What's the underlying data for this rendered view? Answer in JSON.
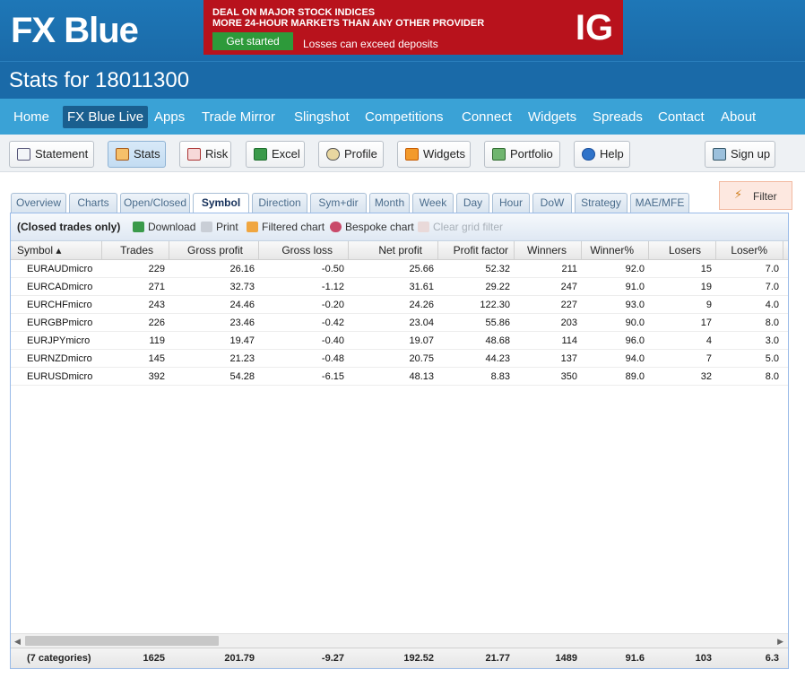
{
  "brand": {
    "logo_text": "FX Blue"
  },
  "ad": {
    "line1": "DEAL ON MAJOR STOCK INDICES",
    "line2": "MORE 24-HOUR MARKETS THAN ANY OTHER PROVIDER",
    "cta": "Get started",
    "note": "Losses can exceed deposits",
    "logo": "IG"
  },
  "page_title": "Stats for 18011300",
  "main_nav": [
    {
      "label": "Home"
    },
    {
      "label": "FX Blue Live",
      "active": true
    },
    {
      "label": "Apps"
    },
    {
      "label": "Trade Mirror"
    },
    {
      "label": "Slingshot"
    },
    {
      "label": "Competitions"
    },
    {
      "label": "Connect"
    },
    {
      "label": "Widgets"
    },
    {
      "label": "Spreads"
    },
    {
      "label": "Contact"
    },
    {
      "label": "About"
    }
  ],
  "toolbar": {
    "statement": "Statement",
    "stats": "Stats",
    "risk": "Risk",
    "excel": "Excel",
    "profile": "Profile",
    "widgets": "Widgets",
    "portfolio": "Portfolio",
    "help": "Help",
    "signup": "Sign up"
  },
  "filter_label": "Filter",
  "tabs": [
    {
      "label": "Overview"
    },
    {
      "label": "Charts"
    },
    {
      "label": "Open/Closed"
    },
    {
      "label": "Symbol",
      "active": true
    },
    {
      "label": "Direction"
    },
    {
      "label": "Sym+dir"
    },
    {
      "label": "Month"
    },
    {
      "label": "Week"
    },
    {
      "label": "Day"
    },
    {
      "label": "Hour"
    },
    {
      "label": "DoW"
    },
    {
      "label": "Strategy"
    },
    {
      "label": "MAE/MFE"
    }
  ],
  "grid_toolbar": {
    "title": "(Closed trades only)",
    "download": "Download",
    "print": "Print",
    "filtered_chart": "Filtered chart",
    "bespoke_chart": "Bespoke chart",
    "clear_filter": "Clear grid filter"
  },
  "grid": {
    "columns": [
      "Symbol ▴",
      "Trades",
      "Gross profit",
      "Gross loss",
      "Net profit",
      "Profit factor",
      "Winners",
      "Winner%",
      "Losers",
      "Loser%"
    ],
    "rows": [
      [
        "EURAUDmicro",
        "229",
        "26.16",
        "-0.50",
        "25.66",
        "52.32",
        "211",
        "92.0",
        "15",
        "7.0"
      ],
      [
        "EURCADmicro",
        "271",
        "32.73",
        "-1.12",
        "31.61",
        "29.22",
        "247",
        "91.0",
        "19",
        "7.0"
      ],
      [
        "EURCHFmicro",
        "243",
        "24.46",
        "-0.20",
        "24.26",
        "122.30",
        "227",
        "93.0",
        "9",
        "4.0"
      ],
      [
        "EURGBPmicro",
        "226",
        "23.46",
        "-0.42",
        "23.04",
        "55.86",
        "203",
        "90.0",
        "17",
        "8.0"
      ],
      [
        "EURJPYmicro",
        "119",
        "19.47",
        "-0.40",
        "19.07",
        "48.68",
        "114",
        "96.0",
        "4",
        "3.0"
      ],
      [
        "EURNZDmicro",
        "145",
        "21.23",
        "-0.48",
        "20.75",
        "44.23",
        "137",
        "94.0",
        "7",
        "5.0"
      ],
      [
        "EURUSDmicro",
        "392",
        "54.28",
        "-6.15",
        "48.13",
        "8.83",
        "350",
        "89.0",
        "32",
        "8.0"
      ]
    ],
    "totals": [
      "(7 categories)",
      "1625",
      "201.79",
      "-9.27",
      "192.52",
      "21.77",
      "1489",
      "91.6",
      "103",
      "6.3"
    ]
  }
}
